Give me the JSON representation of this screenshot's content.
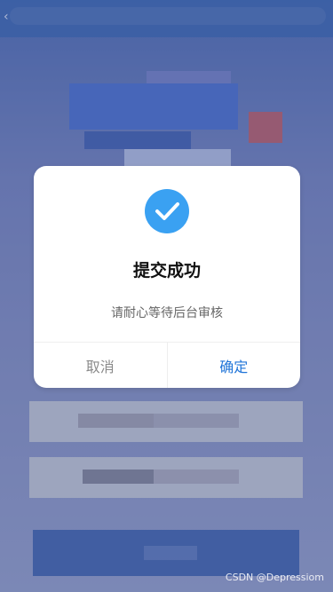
{
  "dialog": {
    "title": "提交成功",
    "message": "请耐心等待后台审核",
    "cancel_label": "取消",
    "confirm_label": "确定",
    "icon": "check-circle-icon",
    "icon_color": "#3aa1f2"
  },
  "watermark": "CSDN @Depressiom",
  "colors": {
    "confirm_text": "#1f74d8",
    "cancel_text": "#8a8a8a"
  }
}
